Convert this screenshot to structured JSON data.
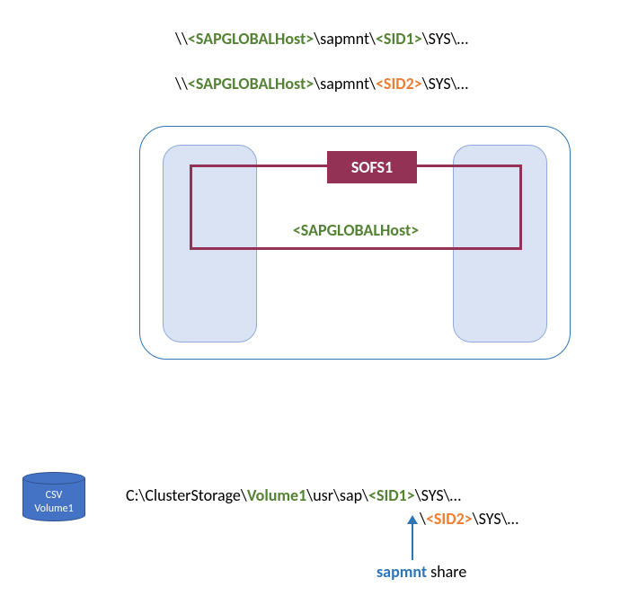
{
  "paths": {
    "line1": {
      "prefix": "\\\\",
      "host": "<SAPGLOBALHost>",
      "mid": "\\sapmnt\\",
      "sid": "<SID1>",
      "suffix": "\\SYS\\…"
    },
    "line2": {
      "prefix": "\\\\",
      "host": "<SAPGLOBALHost>",
      "mid": "\\sapmnt\\",
      "sid": "<SID2>",
      "suffix": "\\SYS\\…"
    }
  },
  "cluster": {
    "role_label": "SOFS1",
    "global_host": "<SAPGLOBALHost>"
  },
  "csv": {
    "disk_line1": "CSV",
    "disk_line2": "Volume1"
  },
  "local_path": {
    "prefix": "C:\\ClusterStorage\\",
    "volume": "Volume1",
    "mid": "\\usr\\sap\\",
    "sid1": "<SID1>",
    "suffix1": "\\SYS\\…",
    "prefix2": "\\",
    "sid2": "<SID2>",
    "suffix2": "\\SYS\\…"
  },
  "annotation": {
    "sapmnt": "sapmnt",
    "share": " share"
  }
}
